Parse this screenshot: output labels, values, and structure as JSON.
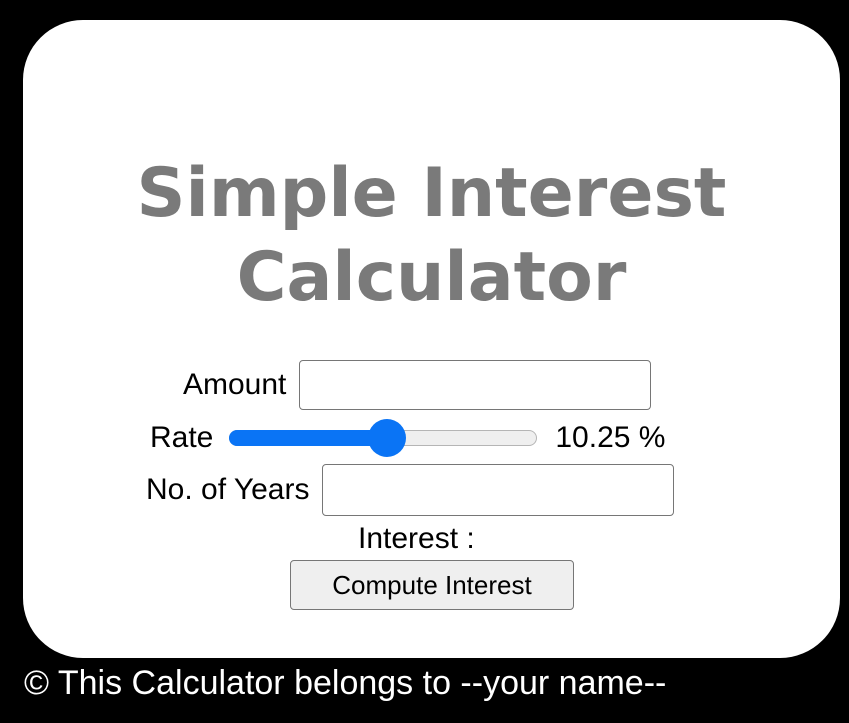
{
  "title": {
    "line1": "Simple Interest",
    "line2": "Calculator"
  },
  "form": {
    "amount": {
      "label": "Amount",
      "value": "",
      "placeholder": ""
    },
    "rate": {
      "label": "Rate",
      "value": 10.25,
      "display": "10.25 %",
      "min": 0,
      "max": 20
    },
    "years": {
      "label": "No. of Years",
      "value": "",
      "placeholder": ""
    },
    "interest": {
      "label": "Interest :",
      "value": ""
    },
    "compute_button": "Compute Interest"
  },
  "footer": "© This Calculator belongs to --your name--",
  "colors": {
    "background": "#000000",
    "card": "#ffffff",
    "title": "#7a7a7a",
    "accent": "#0a74f5"
  }
}
